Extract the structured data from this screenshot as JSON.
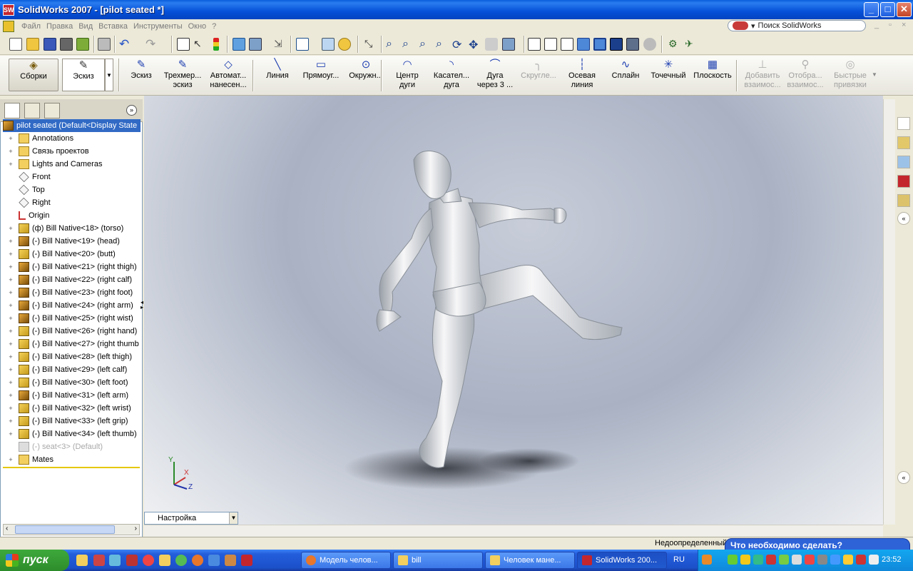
{
  "window": {
    "title": "SolidWorks 2007 - [pilot seated *]",
    "controls": [
      "_",
      "□",
      "✕"
    ]
  },
  "menu": {
    "items": [
      "Файл",
      "Правка",
      "Вид",
      "Вставка",
      "Инструменты",
      "Окно",
      "?"
    ],
    "search_label": "Поиск SolidWorks",
    "search_prefix": "▾"
  },
  "command_manager": {
    "tabs": [
      {
        "label": "Сборки",
        "icon": "assembly-icon"
      },
      {
        "label": "Эскиз",
        "icon": "sketch-icon"
      }
    ],
    "tools": [
      {
        "line1": "Эскиз",
        "line2": "",
        "icon": "sketch-icon",
        "glyph": "✎",
        "disabled": false
      },
      {
        "line1": "Трехмер...",
        "line2": "эскиз",
        "icon": "3d-sketch-icon",
        "glyph": "✎",
        "disabled": false
      },
      {
        "line1": "Автомат...",
        "line2": "нанесен...",
        "icon": "smart-dimension-icon",
        "glyph": "◇",
        "disabled": false
      },
      {
        "line1": "Линия",
        "line2": "",
        "icon": "line-icon",
        "glyph": "╲",
        "disabled": false
      },
      {
        "line1": "Прямоуг...",
        "line2": "",
        "icon": "rectangle-icon",
        "glyph": "▭",
        "disabled": false
      },
      {
        "line1": "Окружн...",
        "line2": "",
        "icon": "circle-icon",
        "glyph": "⊙",
        "disabled": false
      },
      {
        "line1": "Центр",
        "line2": "дуги",
        "icon": "centerpoint-arc-icon",
        "glyph": "◠",
        "disabled": false
      },
      {
        "line1": "Касател...",
        "line2": "дуга",
        "icon": "tangent-arc-icon",
        "glyph": "◝",
        "disabled": false
      },
      {
        "line1": "Дуга",
        "line2": "через 3 ...",
        "icon": "three-point-arc-icon",
        "glyph": "⌒",
        "disabled": false
      },
      {
        "line1": "Скругле...",
        "line2": "",
        "icon": "fillet-icon",
        "glyph": "╮",
        "disabled": true
      },
      {
        "line1": "Осевая",
        "line2": "линия",
        "icon": "centerline-icon",
        "glyph": "┆",
        "disabled": false
      },
      {
        "line1": "Сплайн",
        "line2": "",
        "icon": "spline-icon",
        "glyph": "∿",
        "disabled": false
      },
      {
        "line1": "Точечный",
        "line2": "",
        "icon": "point-icon",
        "glyph": "✳",
        "disabled": false
      },
      {
        "line1": "Плоскость",
        "line2": "",
        "icon": "plane-icon",
        "glyph": "▦",
        "disabled": false
      },
      {
        "line1": "Добавить",
        "line2": "взаимос...",
        "icon": "add-relation-icon",
        "glyph": "⊥",
        "disabled": true
      },
      {
        "line1": "Отобра...",
        "line2": "взаимос...",
        "icon": "display-relations-icon",
        "glyph": "⚲",
        "disabled": true
      },
      {
        "line1": "Быстрые",
        "line2": "привязки",
        "icon": "quick-snaps-icon",
        "glyph": "◎",
        "disabled": true
      }
    ]
  },
  "feature_tree": {
    "root": "pilot seated  (Default<Display State",
    "items": [
      {
        "label": "Annotations",
        "icon": "annotations-icon",
        "kind": "folder",
        "plus": true
      },
      {
        "label": "Связь проектов",
        "icon": "design-binder-icon",
        "kind": "folder",
        "plus": true
      },
      {
        "label": "Lights and Cameras",
        "icon": "lights-icon",
        "kind": "folder",
        "plus": true
      },
      {
        "label": "Front",
        "icon": "plane-icon",
        "kind": "plane",
        "plus": false
      },
      {
        "label": "Top",
        "icon": "plane-icon",
        "kind": "plane",
        "plus": false
      },
      {
        "label": "Right",
        "icon": "plane-icon",
        "kind": "plane",
        "plus": false
      },
      {
        "label": "Origin",
        "icon": "origin-icon",
        "kind": "origin",
        "plus": false
      },
      {
        "label": "(ф) Bill Native<18> (torso)",
        "icon": "part-icon",
        "kind": "comp",
        "plus": true
      },
      {
        "label": "(-) Bill Native<19> (head)",
        "icon": "subassembly-icon",
        "kind": "asm",
        "plus": true
      },
      {
        "label": "(-) Bill Native<20> (butt)",
        "icon": "part-icon",
        "kind": "comp",
        "plus": true
      },
      {
        "label": "(-) Bill Native<21> (right thigh)",
        "icon": "subassembly-icon",
        "kind": "asm",
        "plus": true
      },
      {
        "label": "(-) Bill Native<22> (right calf)",
        "icon": "subassembly-icon",
        "kind": "asm",
        "plus": true
      },
      {
        "label": "(-) Bill Native<23> (right foot)",
        "icon": "subassembly-icon",
        "kind": "asm",
        "plus": true
      },
      {
        "label": "(-) Bill Native<24> (right arm)",
        "icon": "subassembly-icon",
        "kind": "asm",
        "plus": true
      },
      {
        "label": "(-) Bill Native<25> (right wist)",
        "icon": "subassembly-icon",
        "kind": "asm",
        "plus": true
      },
      {
        "label": "(-) Bill Native<26> (right hand)",
        "icon": "part-icon",
        "kind": "comp",
        "plus": true
      },
      {
        "label": "(-) Bill Native<27> (right thumb",
        "icon": "part-icon",
        "kind": "comp",
        "plus": true
      },
      {
        "label": "(-) Bill Native<28> (left thigh)",
        "icon": "part-icon",
        "kind": "comp",
        "plus": true
      },
      {
        "label": "(-) Bill Native<29> (left calf)",
        "icon": "part-icon",
        "kind": "comp",
        "plus": true
      },
      {
        "label": "(-) Bill Native<30> (left foot)",
        "icon": "part-icon",
        "kind": "comp",
        "plus": true
      },
      {
        "label": "(-) Bill Native<31> (left arm)",
        "icon": "subassembly-icon",
        "kind": "asm",
        "plus": true
      },
      {
        "label": "(-) Bill Native<32> (left wrist)",
        "icon": "part-icon",
        "kind": "comp",
        "plus": true
      },
      {
        "label": "(-) Bill Native<33> (left grip)",
        "icon": "part-icon",
        "kind": "comp",
        "plus": true
      },
      {
        "label": "(-) Bill Native<34> (left thumb)",
        "icon": "part-icon",
        "kind": "comp",
        "plus": true
      },
      {
        "label": "(-) seat<3> (Default)",
        "icon": "suppressed-part-icon",
        "kind": "gray",
        "plus": false,
        "dim": true
      },
      {
        "label": "Mates",
        "icon": "mates-icon",
        "kind": "folder",
        "plus": true
      }
    ]
  },
  "viewport": {
    "configuration": "Настройка",
    "triad": {
      "x": "X",
      "y": "Y",
      "z": "Z"
    }
  },
  "status": {
    "text": "Недоопределенный",
    "balloon": "Что необходимо сделать?"
  },
  "taskbar": {
    "start": "пуск",
    "tasks": [
      {
        "label": "Модель челов...",
        "icon": "firefox-icon",
        "color": "#e8762b"
      },
      {
        "label": "bill",
        "icon": "folder-icon",
        "color": "#f2cf5f"
      },
      {
        "label": "Человек мане...",
        "icon": "folder-icon",
        "color": "#f2cf5f"
      },
      {
        "label": "SolidWorks 200...",
        "icon": "solidworks-icon",
        "color": "#c4262e"
      }
    ],
    "lang": "RU",
    "clock": "23:52"
  },
  "colors": {
    "selection": "#316ac5",
    "title_bar": "#0550d8",
    "accent_sketch": "#1e3fb0"
  }
}
